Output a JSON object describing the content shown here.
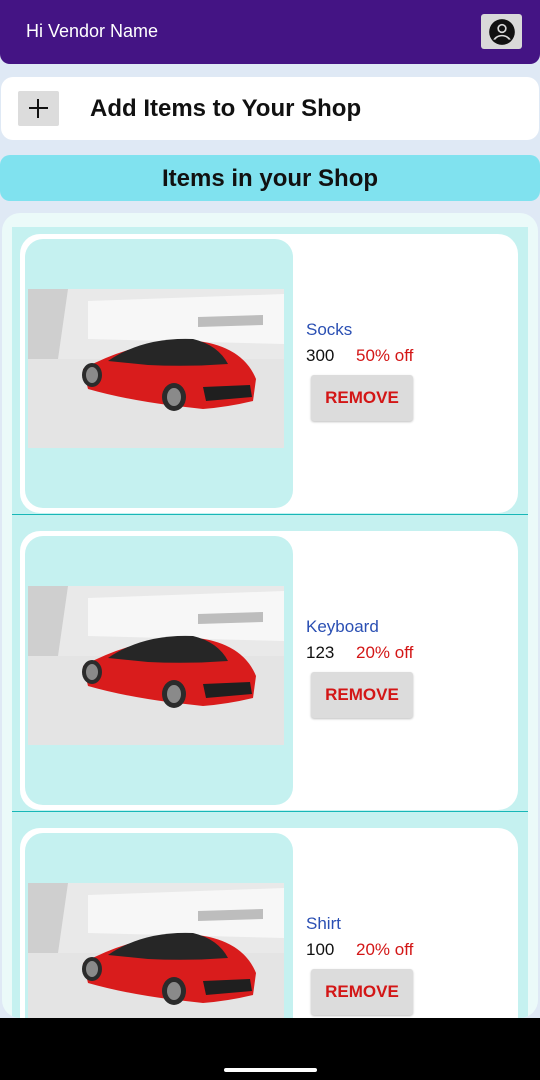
{
  "header": {
    "greeting": "Hi Vendor Name",
    "account_icon": "account-circle-icon"
  },
  "add_items": {
    "icon": "plus-icon",
    "label": "Add Items to Your Shop"
  },
  "section_title": "Items in your Shop",
  "colors": {
    "topbar": "#441484",
    "header_band": "#80e2ef",
    "item_name": "#2a4fb3",
    "discount": "#d31616",
    "card_bg": "#c5f1f0"
  },
  "items": [
    {
      "name": "Socks",
      "price": "300",
      "discount": "50% off",
      "remove_label": "REMOVE"
    },
    {
      "name": "Keyboard",
      "price": "123",
      "discount": "20% off",
      "remove_label": "REMOVE"
    },
    {
      "name": "Shirt",
      "price": "100",
      "discount": "20% off",
      "remove_label": "REMOVE"
    }
  ]
}
